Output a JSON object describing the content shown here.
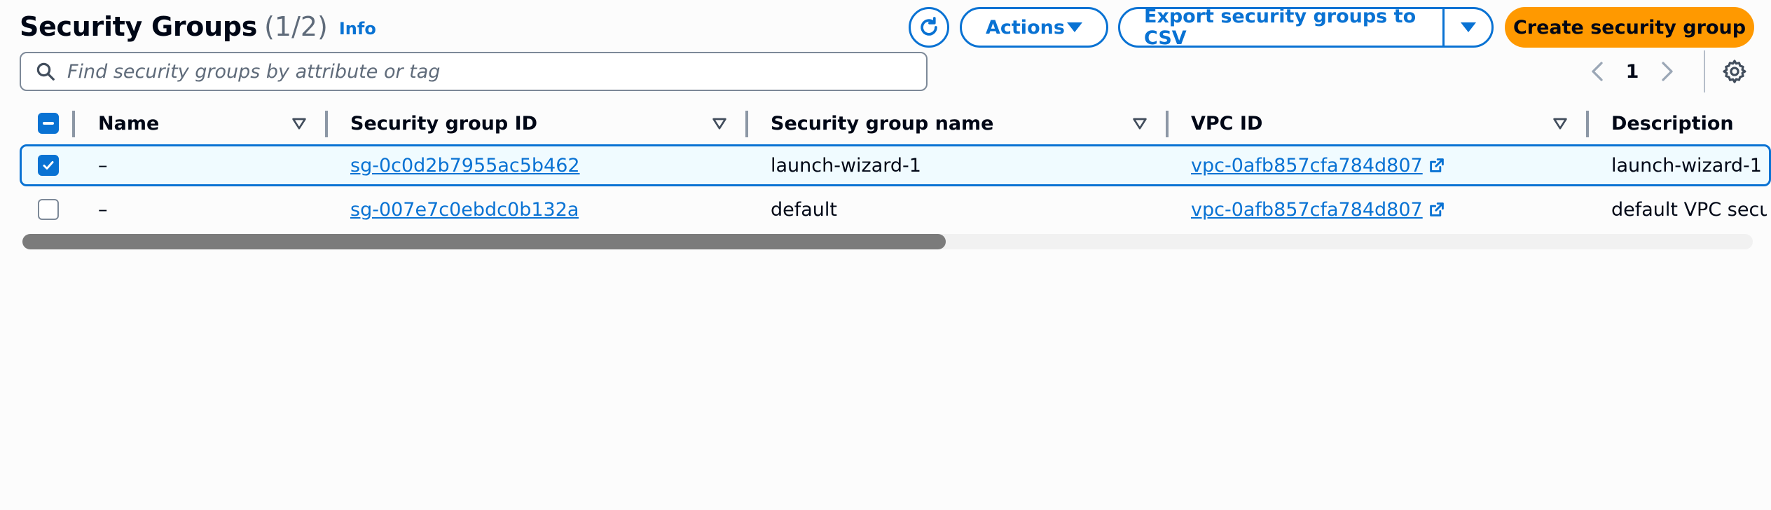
{
  "header": {
    "title": "Security Groups",
    "count": "(1/2)",
    "info": "Info"
  },
  "toolbar": {
    "refresh_icon": "refresh-icon",
    "actions_label": "Actions",
    "export_label": "Export security groups to CSV",
    "create_label": "Create security group"
  },
  "search": {
    "placeholder": "Find security groups by attribute or tag",
    "value": ""
  },
  "pagination": {
    "current_page": "1"
  },
  "table": {
    "columns": [
      "Name",
      "Security group ID",
      "Security group name",
      "VPC ID",
      "Description"
    ],
    "header_checkbox_state": "indeterminate",
    "rows": [
      {
        "selected": true,
        "name": "–",
        "group_id": "sg-0c0d2b7955ac5b462",
        "group_name": "launch-wizard-1",
        "vpc_id": "vpc-0afb857cfa784d807",
        "description": "launch-wizard-1"
      },
      {
        "selected": false,
        "name": "–",
        "group_id": "sg-007e7c0ebdc0b132a",
        "group_name": "default",
        "vpc_id": "vpc-0afb857cfa784d807",
        "description": "default VPC security group"
      }
    ]
  },
  "colors": {
    "accent": "#0972d3",
    "primary_button": "#ff9900",
    "selected_row_bg": "#f0fbff"
  }
}
